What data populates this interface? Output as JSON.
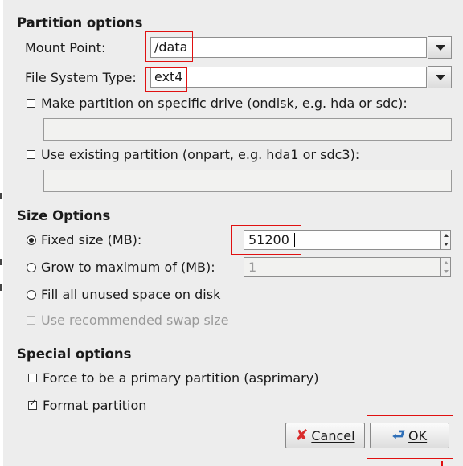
{
  "partition_options": {
    "heading": "Partition options",
    "mount_point": {
      "label": "Mount Point:",
      "value": "/data"
    },
    "fs_type": {
      "label": "File System Type:",
      "value": "ext4"
    },
    "ondisk": {
      "label": "Make partition on specific drive (ondisk, e.g. hda or sdc):",
      "checked": false
    },
    "onpart": {
      "label": "Use existing partition (onpart, e.g. hda1 or sdc3):",
      "checked": false
    }
  },
  "size_options": {
    "heading": "Size Options",
    "fixed": {
      "label": "Fixed size (MB):",
      "value": "51200",
      "selected": true
    },
    "grow": {
      "label": "Grow to maximum of (MB):",
      "value": "1",
      "selected": false
    },
    "fill": {
      "label": "Fill all unused space on disk",
      "selected": false
    },
    "swap": {
      "label": "Use recommended swap size",
      "checked": false,
      "disabled": true
    }
  },
  "special_options": {
    "heading": "Special options",
    "primary": {
      "label": "Force to be a primary partition (asprimary)",
      "checked": false
    },
    "format": {
      "label": "Format partition",
      "checked": true
    }
  },
  "buttons": {
    "cancel": {
      "label": "Cancel",
      "icon": "cancel-x-icon"
    },
    "ok": {
      "label": "OK",
      "icon": "enter-arrow-icon"
    }
  },
  "colors": {
    "highlight_box": "#e01010",
    "background": "#ededed",
    "cancel_icon": "#d92b2b",
    "ok_icon": "#2f6fb8"
  }
}
